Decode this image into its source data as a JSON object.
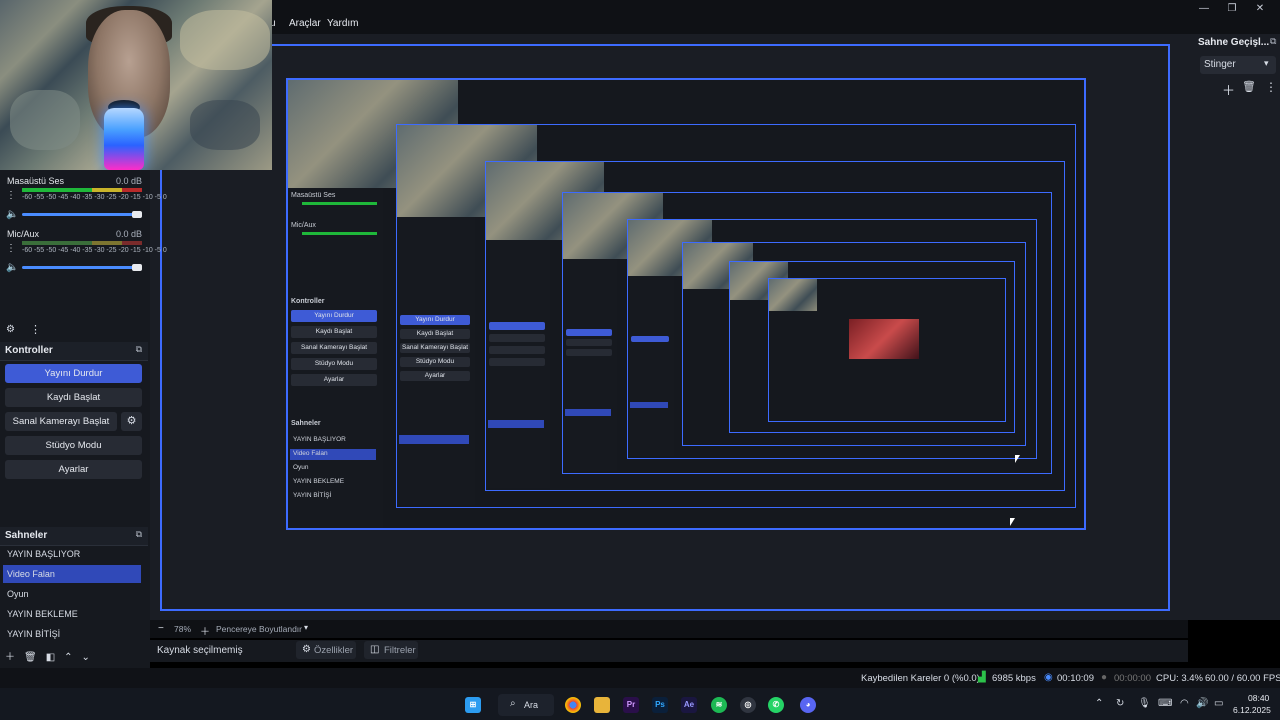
{
  "menu": {
    "items": [
      "u",
      "Araçlar",
      "Yardım"
    ]
  },
  "mixer": {
    "channels": [
      {
        "label": "Masaüstü Ses",
        "db": "0.0 dB",
        "scale": "-60 -55 -50 -45 -40 -35 -30 -25 -20 -15 -10 -5 0"
      },
      {
        "label": "Mic/Aux",
        "db": "0.0 dB",
        "scale": "-60 -55 -50 -45 -40 -35 -30 -25 -20 -15 -10 -5 0"
      }
    ]
  },
  "controls": {
    "title": "Kontroller",
    "buttons": [
      "Yayını Durdur",
      "Kaydı Başlat",
      "Sanal Kamerayı Başlat",
      "Stüdyo Modu",
      "Ayarlar"
    ]
  },
  "scenes": {
    "title": "Sahneler",
    "items": [
      "YAYIN BAŞLIYOR",
      "Video Falan",
      "Oyun",
      "YAYIN BEKLEME",
      "YAYIN BİTİŞİ"
    ],
    "selected_index": 1
  },
  "transitions": {
    "title": "Sahne Geçişl...",
    "selected": "Stinger"
  },
  "preview": {
    "zoom": "78%",
    "resize_label": "Pencereye Boyutlandır",
    "source_none": "Kaynak seçilmemiş",
    "properties_label": "Özellikler",
    "filters_label": "Filtreler"
  },
  "status": {
    "dropped_frames": "Kaybedilen Kareler 0 (%0.0)",
    "bitrate": "6985 kbps",
    "stream_time": "00:10:09",
    "rec_time": "00:00:00",
    "cpu": "CPU: 3.4%",
    "fps": "60.00 / 60.00 FPS"
  },
  "taskbar": {
    "search_label": "Ara",
    "apps": [
      "Pr",
      "Ps",
      "Ae"
    ],
    "clock_time": "08:40",
    "clock_date": "6.12.2025"
  },
  "colors": {
    "accent": "#3d6bff",
    "selected": "#3049b8",
    "button_active": "#3e5bd6"
  }
}
